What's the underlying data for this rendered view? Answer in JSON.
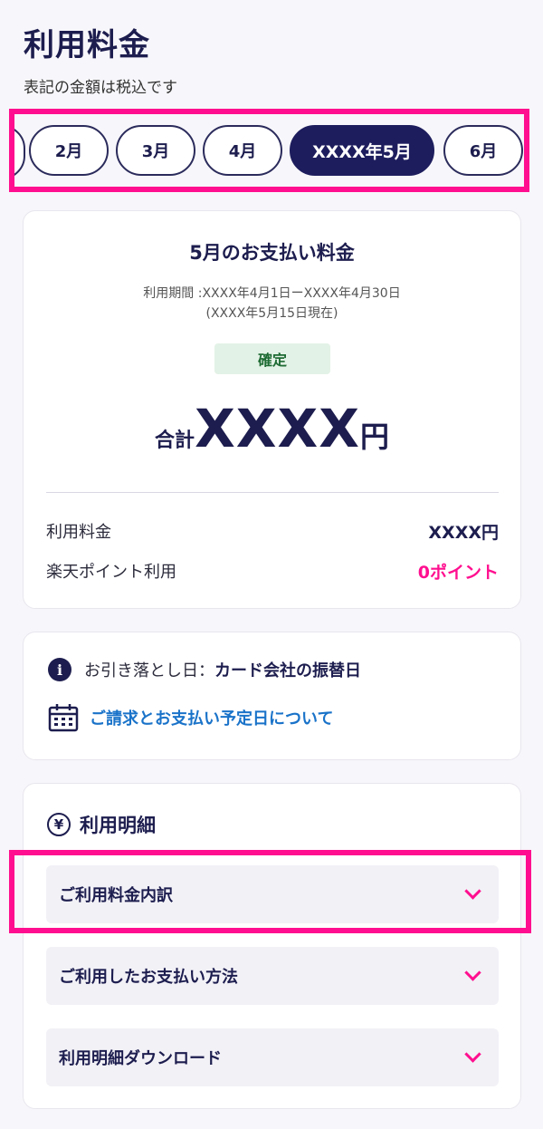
{
  "header": {
    "title": "利用料金",
    "subtitle": "表記の金額は税込です"
  },
  "months": [
    "2月",
    "3月",
    "4月",
    "XXXX年5月",
    "6月"
  ],
  "summary": {
    "title": "5月のお支払い料金",
    "period_line1": "利用期間 :XXXX年4月1日ーXXXX年4月30日",
    "period_line2": "(XXXX年5月15日現在)",
    "status": "確定",
    "total_label": "合計",
    "total_amount": "XXXX",
    "total_unit": "円",
    "rows": [
      {
        "label": "利用料金",
        "value": "XXXX円"
      },
      {
        "label": "楽天ポイント利用",
        "value": "0ポイント"
      }
    ]
  },
  "debit": {
    "label": "お引き落とし日：",
    "value": "カード会社の振替日",
    "link": "ご請求とお支払い予定日について"
  },
  "details": {
    "title": "利用明細",
    "items": [
      "ご利用料金内訳",
      "ご利用したお支払い方法",
      "利用明細ダウンロード"
    ]
  },
  "colors": {
    "accent": "#ff0f8f",
    "navy": "#1d1d5e",
    "link": "#1a73c9"
  }
}
